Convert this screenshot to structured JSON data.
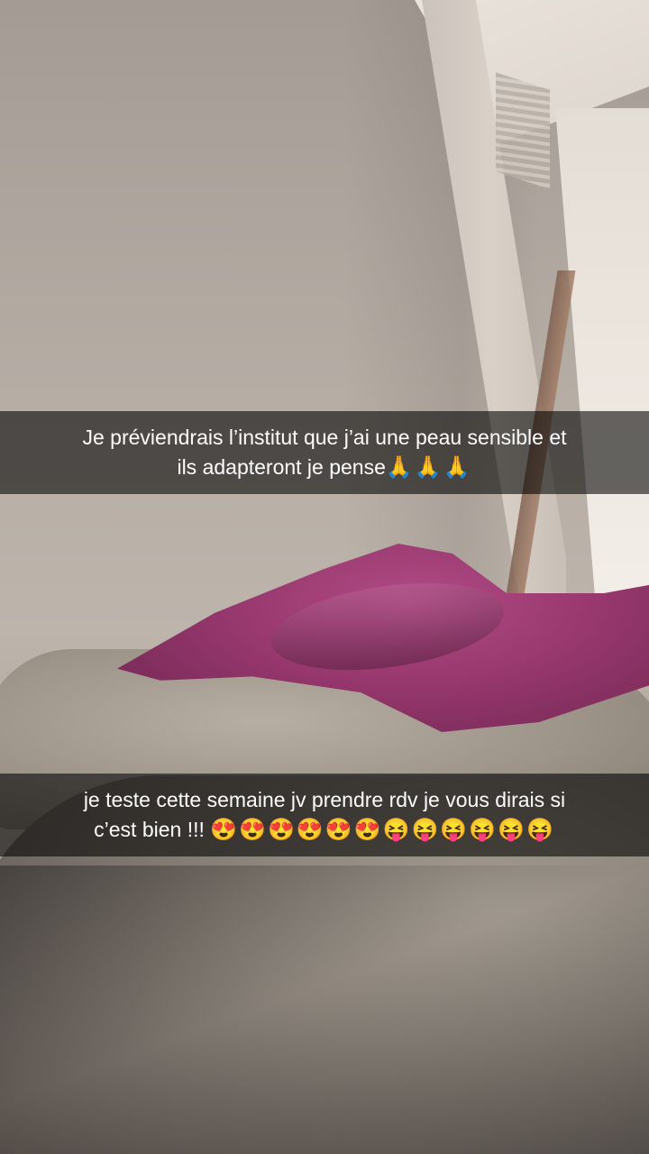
{
  "captions": [
    {
      "line1": "Je préviendrais l’institut que j’ai une peau sensible et",
      "line2_text": "ils adapteront je pense",
      "line2_emoji": "🙏🙏🙏"
    },
    {
      "line1": "je teste cette semaine jv prendre rdv je vous dirais si",
      "line2_text": "c’est bien !!! ",
      "line2_emoji": "😍😍😍😍😍😍😝😝😝😝😝😝"
    }
  ],
  "colors": {
    "caption_bar": "#000000",
    "caption_text": "#ffffff",
    "blanket": "#96376d",
    "cushion": "#9c9388",
    "wall": "#b6ada5"
  }
}
